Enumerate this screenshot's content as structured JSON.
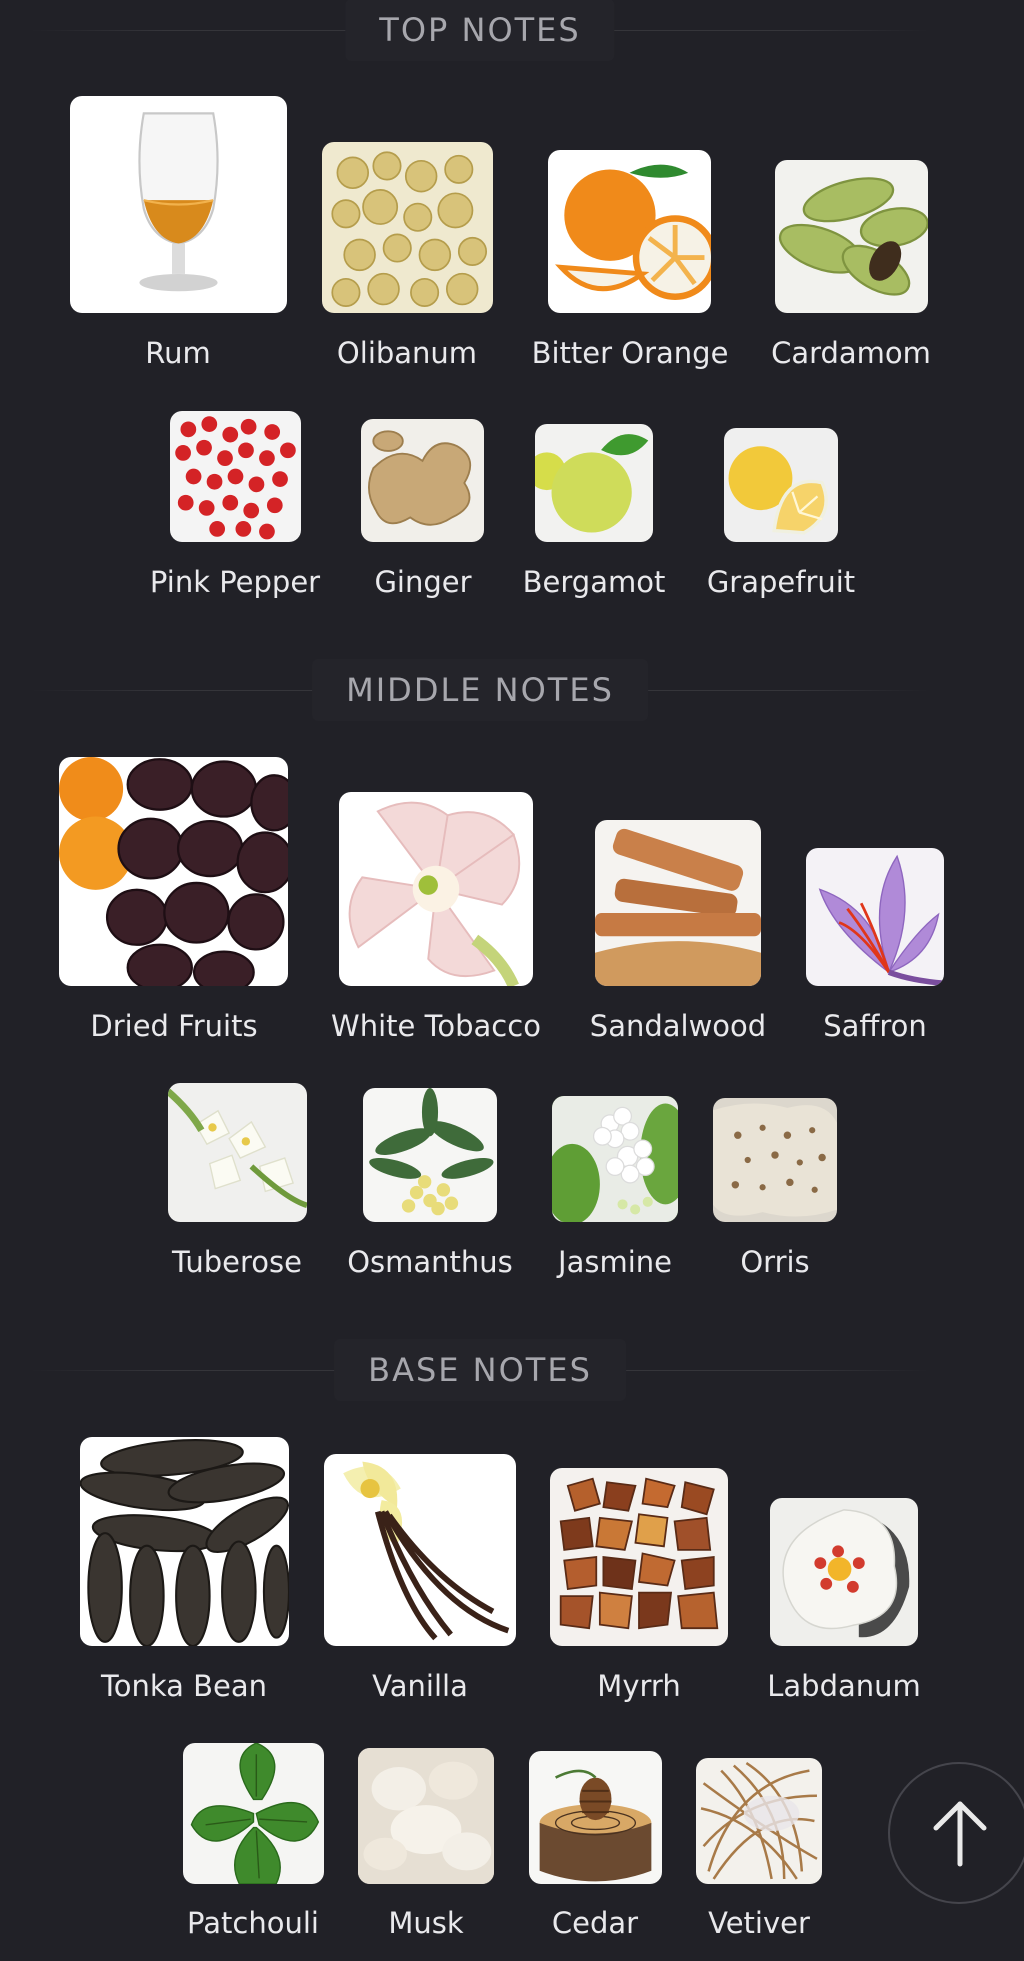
{
  "sections": {
    "top": {
      "title": "TOP NOTES",
      "notes": [
        "Rum",
        "Olibanum",
        "Bitter Orange",
        "Cardamom",
        "Pink Pepper",
        "Ginger",
        "Bergamot",
        "Grapefruit"
      ]
    },
    "middle": {
      "title": "MIDDLE NOTES",
      "notes": [
        "Dried Fruits",
        "White Tobacco",
        "Sandalwood",
        "Saffron",
        "Tuberose",
        "Osmanthus",
        "Jasmine",
        "Orris"
      ]
    },
    "base": {
      "title": "BASE NOTES",
      "notes": [
        "Tonka Bean",
        "Vanilla",
        "Myrrh",
        "Labdanum",
        "Patchouli",
        "Musk",
        "Cedar",
        "Vetiver"
      ]
    }
  },
  "icons": {
    "scroll_top": "arrow-up-icon"
  },
  "colors": {
    "background": "#212127",
    "header_text": "#a7a7ad",
    "label_text": "#e9e9ec"
  }
}
